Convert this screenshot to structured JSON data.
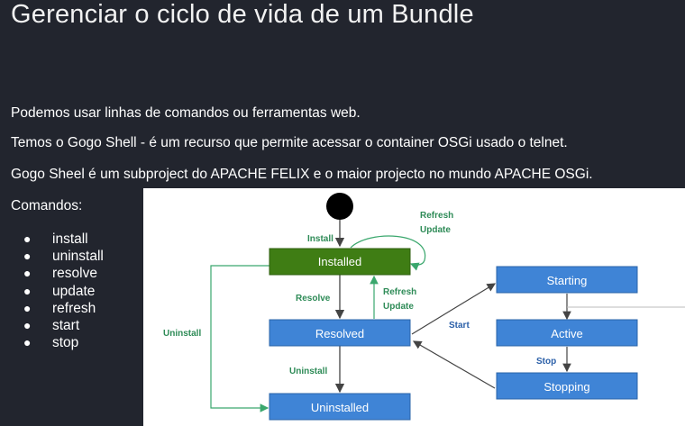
{
  "slide": {
    "title": "Gerenciar o ciclo de vida de um Bundle",
    "paragraphs": [
      "Podemos usar linhas de comandos ou ferramentas web.",
      "Temos o Gogo Shell - é um recurso que permite acessar o container OSGi usado o telnet.",
      "Gogo Sheel é um subproject do APACHE FELIX e o maior projecto no mundo APACHE OSGi.",
      "Comandos:"
    ],
    "commands": [
      "install",
      "uninstall",
      "resolve",
      "update",
      "refresh",
      "start",
      "stop"
    ],
    "bullet": "●"
  },
  "diagram": {
    "states": {
      "installed": "Installed",
      "resolved": "Resolved",
      "uninstalled": "Uninstalled",
      "starting": "Starting",
      "active": "Active",
      "stopping": "Stopping"
    },
    "labels": {
      "install": "Install",
      "refresh_update_top_1": "Refresh",
      "refresh_update_top_2": "Update",
      "resolve": "Resolve",
      "refresh_update_mid_1": "Refresh",
      "refresh_update_mid_2": "Update",
      "uninstall_left": "Uninstall",
      "uninstall_bottom": "Uninstall",
      "start": "Start",
      "stop": "Stop"
    },
    "colors": {
      "installed_fill": "#3f7d14",
      "state_fill": "#3f84d6",
      "label_green": "#2e8b57",
      "label_blue": "#2a5fa8",
      "arrow": "#444444"
    }
  }
}
